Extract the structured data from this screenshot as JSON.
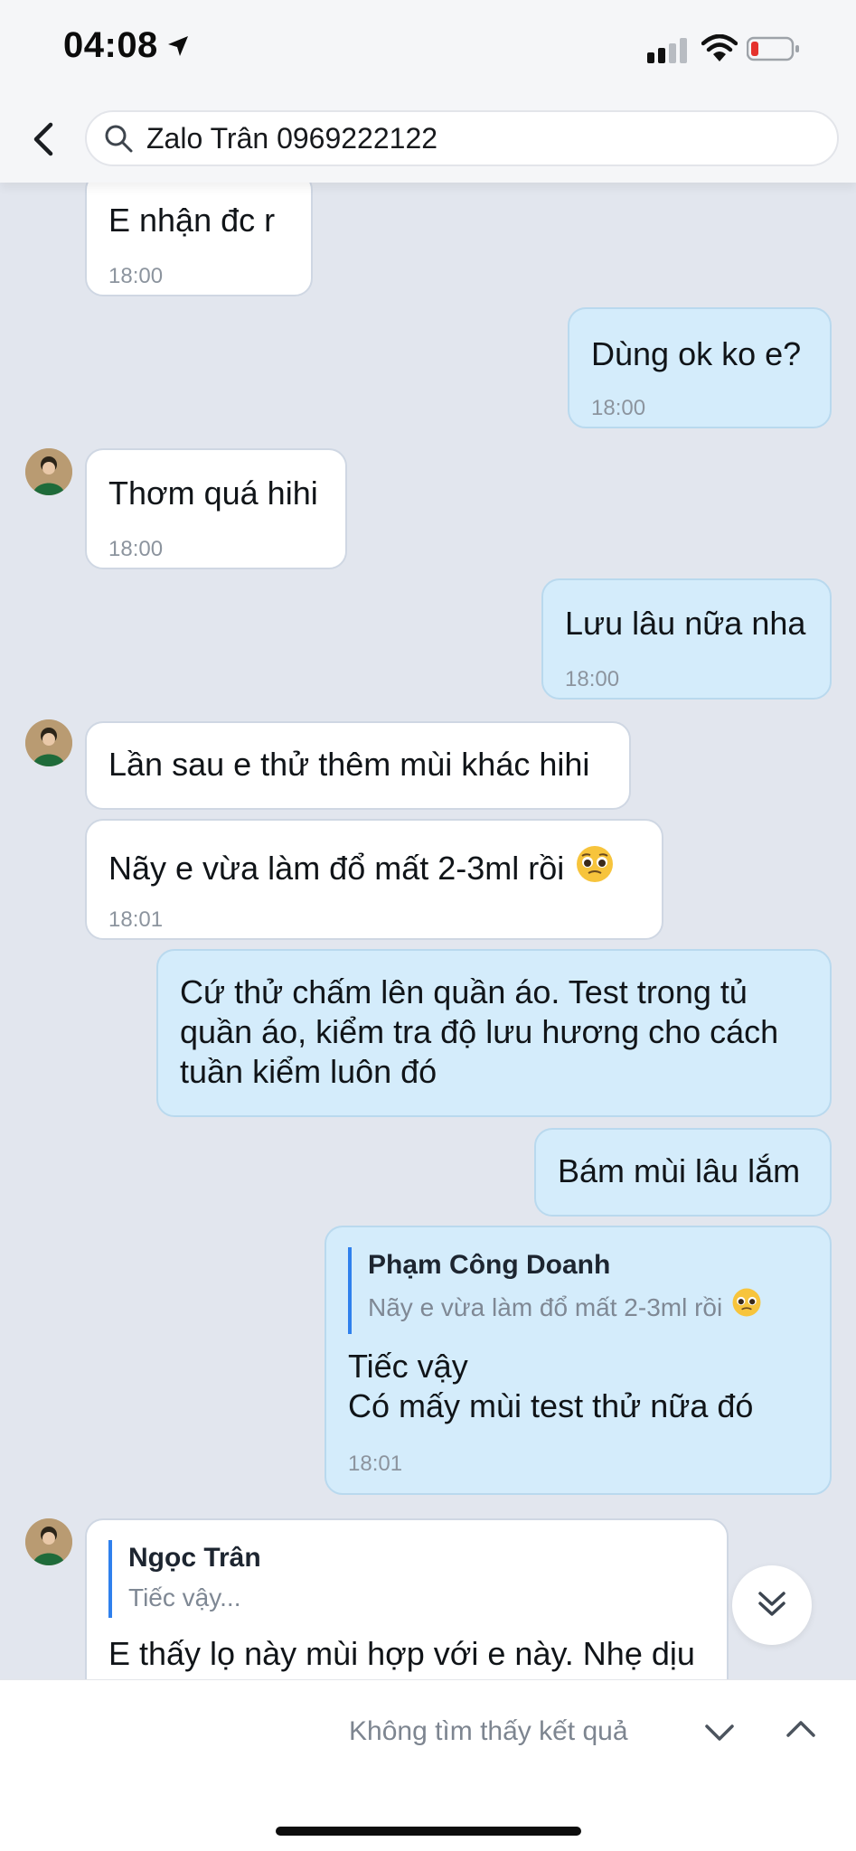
{
  "status_bar": {
    "time": "04:08",
    "icons": [
      "location-arrow-icon",
      "signal-icon",
      "wifi-icon",
      "battery-low-icon"
    ],
    "battery_color": "#e5322d"
  },
  "header": {
    "back_icon": "chevron-left-icon",
    "search_icon": "magnifier-icon",
    "search_value": "Zalo Trân 0969222122"
  },
  "messages": [
    {
      "dir": "in",
      "text": "E nhận đc r",
      "time": "18:00"
    },
    {
      "dir": "out",
      "text": "Dùng ok ko e?",
      "time": "18:00"
    },
    {
      "dir": "in",
      "text": "Thơm quá hihi",
      "time": "18:00"
    },
    {
      "dir": "out",
      "text": "Lưu lâu nữa nha",
      "time": "18:00"
    },
    {
      "dir": "in",
      "text": "Lần sau e thử thêm mùi khác hihi"
    },
    {
      "dir": "in",
      "text": "Nãy e vừa làm đổ mất 2-3ml rồi",
      "emoji": "pleading-face-emoji",
      "time": "18:01"
    },
    {
      "dir": "out",
      "lines": [
        "Cứ thử chấm lên quần áo. Test trong tủ",
        "quần áo, kiểm tra độ lưu hương cho cách",
        "tuần kiểm luôn đó"
      ]
    },
    {
      "dir": "out",
      "text": "Bám mùi lâu lắm"
    },
    {
      "dir": "out",
      "reply": {
        "name": "Phạm Công Doanh",
        "text": "Nãy e vừa làm đổ mất 2-3ml rồi",
        "emoji": "pleading-face-emoji"
      },
      "lines": [
        "Tiếc vậy",
        "Có mấy mùi test thử nữa đó"
      ],
      "time": "18:01"
    },
    {
      "dir": "in",
      "reply": {
        "name": "Ngọc Trân",
        "text": "Tiếc vậy..."
      },
      "text": "E thấy lọ này mùi hợp với e này. Nhẹ dịu"
    }
  ],
  "scroll_button_icon": "double-chevron-down-icon",
  "bottom_bar": {
    "status": "Không tìm thấy kết quả",
    "prev_icon": "chevron-down-icon",
    "next_icon": "chevron-up-icon"
  },
  "colors": {
    "chat_background": "#e2e6ee",
    "incoming_bubble": "#ffffff",
    "outgoing_bubble": "#d4ecfb",
    "reply_bar": "#2f80ed"
  }
}
